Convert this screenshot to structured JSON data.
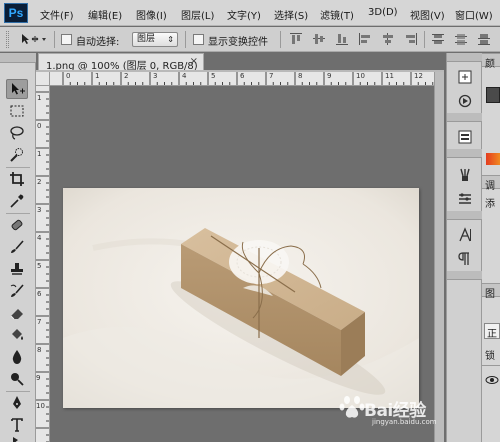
{
  "app": {
    "logo": "Ps"
  },
  "menu": {
    "items": [
      "文件(F)",
      "编辑(E)",
      "图像(I)",
      "图层(L)",
      "文字(Y)",
      "选择(S)",
      "滤镜(T)",
      "3D(D)",
      "视图(V)",
      "窗口(W)"
    ]
  },
  "options": {
    "auto_select_label": "自动选择:",
    "auto_select_value": "图层",
    "show_transform_label": "显示变换控件"
  },
  "document": {
    "tab_title": "1.png @ 100% (图层 0, RGB/8)",
    "close_glyph": "×"
  },
  "rulers": {
    "top": [
      "0",
      "1",
      "2",
      "3",
      "4",
      "5",
      "6",
      "7",
      "8",
      "9",
      "10",
      "11",
      "12"
    ],
    "left": [
      "1",
      "0",
      "1",
      "2",
      "3",
      "4",
      "5",
      "6",
      "7",
      "8",
      "9",
      "10",
      "11"
    ]
  },
  "tools": [
    {
      "name": "move-tool-icon",
      "active": true
    },
    {
      "name": "marquee-tool-icon"
    },
    {
      "name": "lasso-tool-icon"
    },
    {
      "name": "quick-select-tool-icon"
    },
    {
      "name": "crop-tool-icon"
    },
    {
      "name": "eyedropper-tool-icon"
    },
    {
      "name": "healing-brush-tool-icon"
    },
    {
      "name": "brush-tool-icon"
    },
    {
      "name": "clone-stamp-tool-icon"
    },
    {
      "name": "history-brush-tool-icon"
    },
    {
      "name": "eraser-tool-icon"
    },
    {
      "name": "paint-bucket-tool-icon"
    },
    {
      "name": "blur-tool-icon"
    },
    {
      "name": "dodge-tool-icon"
    },
    {
      "name": "pen-tool-icon"
    },
    {
      "name": "type-tool-icon"
    },
    {
      "name": "path-select-tool-icon"
    }
  ],
  "right_panel": {
    "labels": [
      "颜",
      "调",
      "添",
      "图",
      "正",
      "锁"
    ]
  },
  "watermark": {
    "text": "Bai经验",
    "sub": "jingyan.baidu.com"
  }
}
